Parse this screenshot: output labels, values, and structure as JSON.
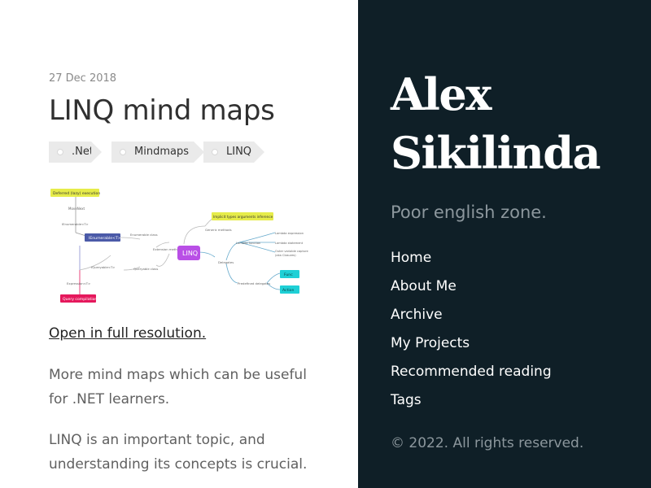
{
  "post": {
    "date": "27 Dec 2018",
    "title": "LINQ mind maps",
    "tags": [
      ".Net",
      "Mindmaps",
      "LINQ"
    ],
    "full_link": "Open in full resolution.",
    "paragraphs": [
      "More mind maps which can be useful for .NET learners.",
      "LINQ is an important topic, and understanding its concepts is crucial."
    ]
  },
  "mindmap": {
    "center": "LINQ",
    "deferred": "Deferred (lazy) execution",
    "movenext": "MoveNext",
    "ienumerable_t": "IEnumerable<T>",
    "ienumerable": "IEnumerable<T>",
    "iqueryable": "IQueryable<T>",
    "expression": "Expression<T>",
    "query_compilation": "Query compilation",
    "enumerable_class": "Enumerable class",
    "extension_methods": "Extension methods",
    "queryable_class": "Queryable class",
    "implicit_types": "Implicit types arguments inference",
    "generic_methods": "Generic methods",
    "lambda_function": "Lambda function",
    "lambda_expression": "Lambda expression",
    "lambda_statement": "Lambda statement",
    "outer_variable": "Outer variable capture",
    "closures": "(aka Closures)",
    "delegates": "Delegates",
    "predefined": "Predefined delegates",
    "func": "Func",
    "action": "Action"
  },
  "sidebar": {
    "author_first": "Alex",
    "author_last": "Sikilinda",
    "tagline": "Poor english zone.",
    "nav": [
      "Home",
      "About Me",
      "Archive",
      "My Projects",
      "Recommended reading",
      "Tags"
    ],
    "copyright": "© 2022. All rights reserved."
  },
  "colors": {
    "sidebar_bg": "#0f1f27",
    "linq_node": "#b94fe6",
    "ienumerable_node": "#4b5aa8",
    "yellow_node": "#e6ec4a",
    "pink_node": "#e5185c",
    "cyan_node": "#1fd0d6"
  }
}
